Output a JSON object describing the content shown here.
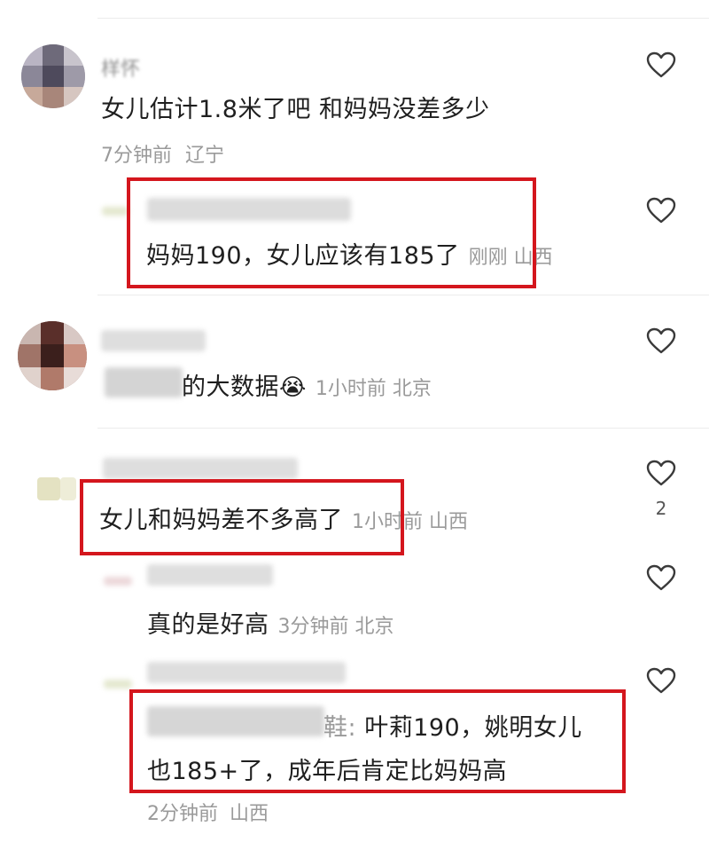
{
  "comments": [
    {
      "username": "样怀",
      "text": "女儿估计1.8米了吧 和妈妈没差多少",
      "time": "7分钟前",
      "location": "辽宁",
      "reply": {
        "text": "妈妈190，女儿应该有185了",
        "time": "刚刚",
        "location": "山西"
      }
    },
    {
      "text": "的大数据",
      "emoji": "😭",
      "time": "1小时前",
      "location": "北京"
    },
    {
      "text": "女儿和妈妈差不多高了",
      "time": "1小时前",
      "location": "山西",
      "likes": "2",
      "replies": [
        {
          "text": "真的是好高",
          "time": "3分钟前",
          "location": "北京"
        },
        {
          "quote_suffix": "鞋:",
          "line1": " 叶莉190，姚明女儿",
          "line2": "也185+了，成年后肯定比妈妈高",
          "time": "2分钟前",
          "location": "山西"
        }
      ]
    }
  ],
  "colors": {
    "highlight_box": "#d4161d",
    "meta_text": "#9a9a9a",
    "body_text": "#1f1f1f"
  },
  "icons": [
    "heart-outline-icon"
  ]
}
